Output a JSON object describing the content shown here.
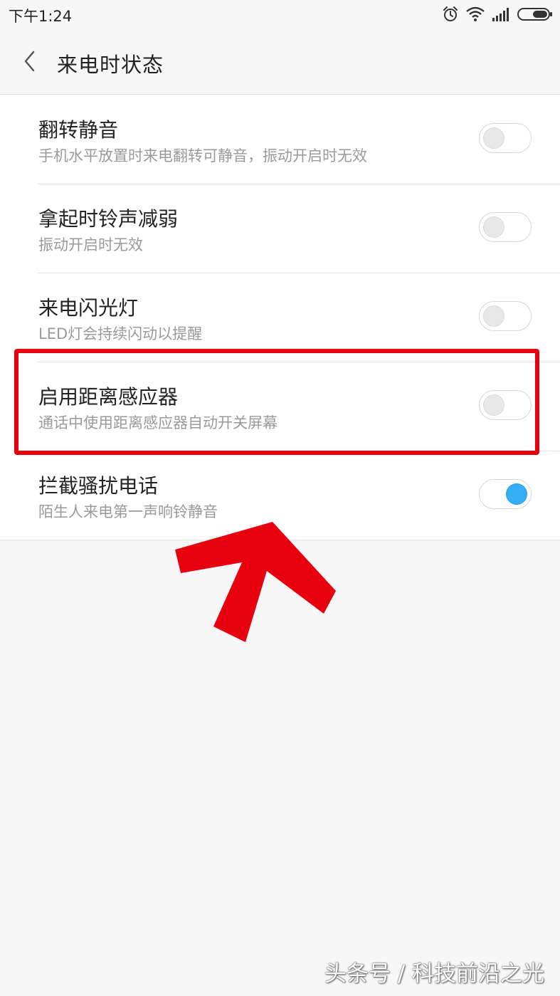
{
  "status_bar": {
    "time": "下午1:24",
    "icons": [
      "alarm-icon",
      "wifi-icon",
      "signal-icon",
      "battery-icon"
    ]
  },
  "header": {
    "back_icon": "chevron-left-icon",
    "title": "来电时状态"
  },
  "settings": [
    {
      "title": "翻转静音",
      "subtitle": "手机水平放置时来电翻转可静音，振动开启时无效",
      "enabled": false
    },
    {
      "title": "拿起时铃声减弱",
      "subtitle": "振动开启时无效",
      "enabled": false
    },
    {
      "title": "来电闪光灯",
      "subtitle": "LED灯会持续闪动以提醒",
      "enabled": false
    },
    {
      "title": "启用距离感应器",
      "subtitle": "通话中使用距离感应器自动开关屏幕",
      "enabled": false
    },
    {
      "title": "拦截骚扰电话",
      "subtitle": "陌生人来电第一声响铃静音",
      "enabled": true
    }
  ],
  "annotation": {
    "highlight_color": "#e8000f",
    "arrow_color": "#e8000f"
  },
  "watermark": "头条号 / 科技前沿之光",
  "colors": {
    "accent": "#36adf7",
    "background": "#f7f7f7",
    "card": "#ffffff"
  }
}
